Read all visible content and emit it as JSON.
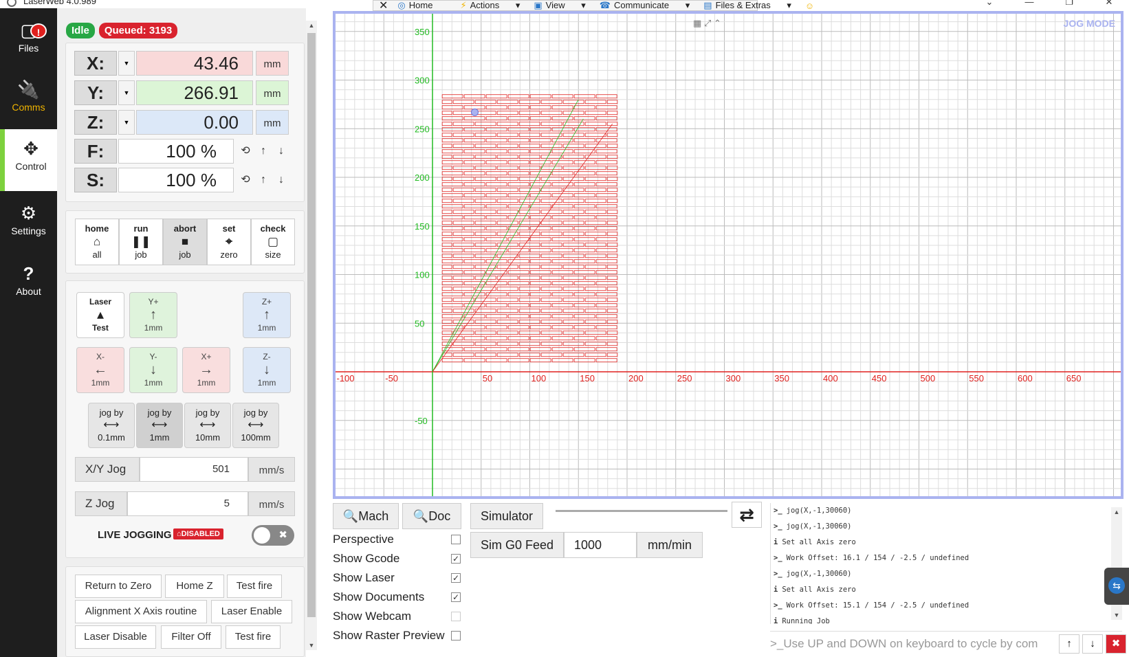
{
  "window": {
    "title": "LaserWeb 4.0.989"
  },
  "top_menu": [
    {
      "label": "Home",
      "icon": "home-icon"
    },
    {
      "label": "Actions",
      "icon": "actions-icon"
    },
    {
      "label": "View",
      "icon": "view-icon"
    },
    {
      "label": "Communicate",
      "icon": "communicate-icon"
    },
    {
      "label": "Files & Extras",
      "icon": "files-icon"
    }
  ],
  "nav": {
    "files": "Files",
    "files_badge": "!",
    "comms": "Comms",
    "control": "Control",
    "settings": "Settings",
    "about": "About"
  },
  "status": {
    "state": "Idle",
    "queued": "Queued: 3193"
  },
  "dro": {
    "x": {
      "label": "X:",
      "value": "43.46",
      "unit": "mm"
    },
    "y": {
      "label": "Y:",
      "value": "266.91",
      "unit": "mm"
    },
    "z": {
      "label": "Z:",
      "value": "0.00",
      "unit": "mm"
    },
    "f": {
      "label": "F:",
      "value": "100 %"
    },
    "s": {
      "label": "S:",
      "value": "100 %"
    }
  },
  "commands": [
    {
      "top": "home",
      "bottom": "all"
    },
    {
      "top": "run",
      "bottom": "job"
    },
    {
      "top": "abort",
      "bottom": "job"
    },
    {
      "top": "set",
      "bottom": "zero"
    },
    {
      "top": "check",
      "bottom": "size"
    }
  ],
  "jog": {
    "laser_test": {
      "top": "Laser",
      "bottom": "Test"
    },
    "y_plus": {
      "top": "Y+",
      "bottom": "1mm"
    },
    "z_plus": {
      "top": "Z+",
      "bottom": "1mm"
    },
    "x_minus": {
      "top": "X-",
      "bottom": "1mm"
    },
    "y_minus": {
      "top": "Y-",
      "bottom": "1mm"
    },
    "x_plus": {
      "top": "X+",
      "bottom": "1mm"
    },
    "z_minus": {
      "top": "Z-",
      "bottom": "1mm"
    }
  },
  "jog_by": [
    {
      "top": "jog by",
      "bottom": "0.1mm"
    },
    {
      "top": "jog by",
      "bottom": "1mm"
    },
    {
      "top": "jog by",
      "bottom": "10mm"
    },
    {
      "top": "jog by",
      "bottom": "100mm"
    }
  ],
  "xy_jog": {
    "label": "X/Y Jog",
    "value": "501",
    "unit": "mm/s"
  },
  "z_jog": {
    "label": "Z Jog",
    "value": "5",
    "unit": "mm/s"
  },
  "live_jogging": {
    "label": "LIVE JOGGING",
    "state": "DISABLED"
  },
  "macros": [
    "Return to Zero",
    "Home Z",
    "Test fire",
    "Alignment X Axis routine",
    "Laser Enable",
    "Laser Disable",
    "Filter Off",
    "Test fire"
  ],
  "viewport": {
    "mode": "JOG MODE",
    "x_ticks": [
      "-100",
      "-50",
      "50",
      "100",
      "150",
      "200",
      "250",
      "300",
      "350",
      "400",
      "450",
      "500",
      "550",
      "600",
      "650"
    ],
    "y_ticks": [
      "350",
      "300",
      "250",
      "200",
      "150",
      "100",
      "50",
      "-50"
    ]
  },
  "view_buttons": {
    "mach": "Mach",
    "doc": "Doc"
  },
  "simulator": {
    "label": "Simulator",
    "feed_label": "Sim G0 Feed",
    "feed_value": "1000",
    "feed_unit": "mm/min"
  },
  "options": [
    {
      "label": "Perspective",
      "checked": false
    },
    {
      "label": "Show Gcode",
      "checked": true
    },
    {
      "label": "Show Laser",
      "checked": true
    },
    {
      "label": "Show Documents",
      "checked": true
    },
    {
      "label": "Show Webcam",
      "checked": false
    },
    {
      "label": "Show Raster Preview",
      "checked": false
    }
  ],
  "console": [
    {
      "prefix": ">_",
      "text": "jog(X,-1,30060)"
    },
    {
      "prefix": ">_",
      "text": "jog(X,-1,30060)"
    },
    {
      "prefix": "i",
      "text": "Set all Axis zero"
    },
    {
      "prefix": ">_",
      "text": "Work Offset: 16.1 / 154 / -2.5 / undefined"
    },
    {
      "prefix": ">_",
      "text": "jog(X,-1,30060)"
    },
    {
      "prefix": "i",
      "text": "Set all Axis zero"
    },
    {
      "prefix": ">_",
      "text": "Work Offset: 15.1 / 154 / -2.5 / undefined"
    },
    {
      "prefix": "i",
      "text": "Running Job"
    }
  ],
  "command_input": {
    "prompt": ">_",
    "placeholder": "Use UP and DOWN on keyboard to cycle by com"
  },
  "colors": {
    "accent_green": "#7dd13d",
    "danger": "#d9232e",
    "idle": "#28a745",
    "viewport_border": "#aab3f0"
  }
}
